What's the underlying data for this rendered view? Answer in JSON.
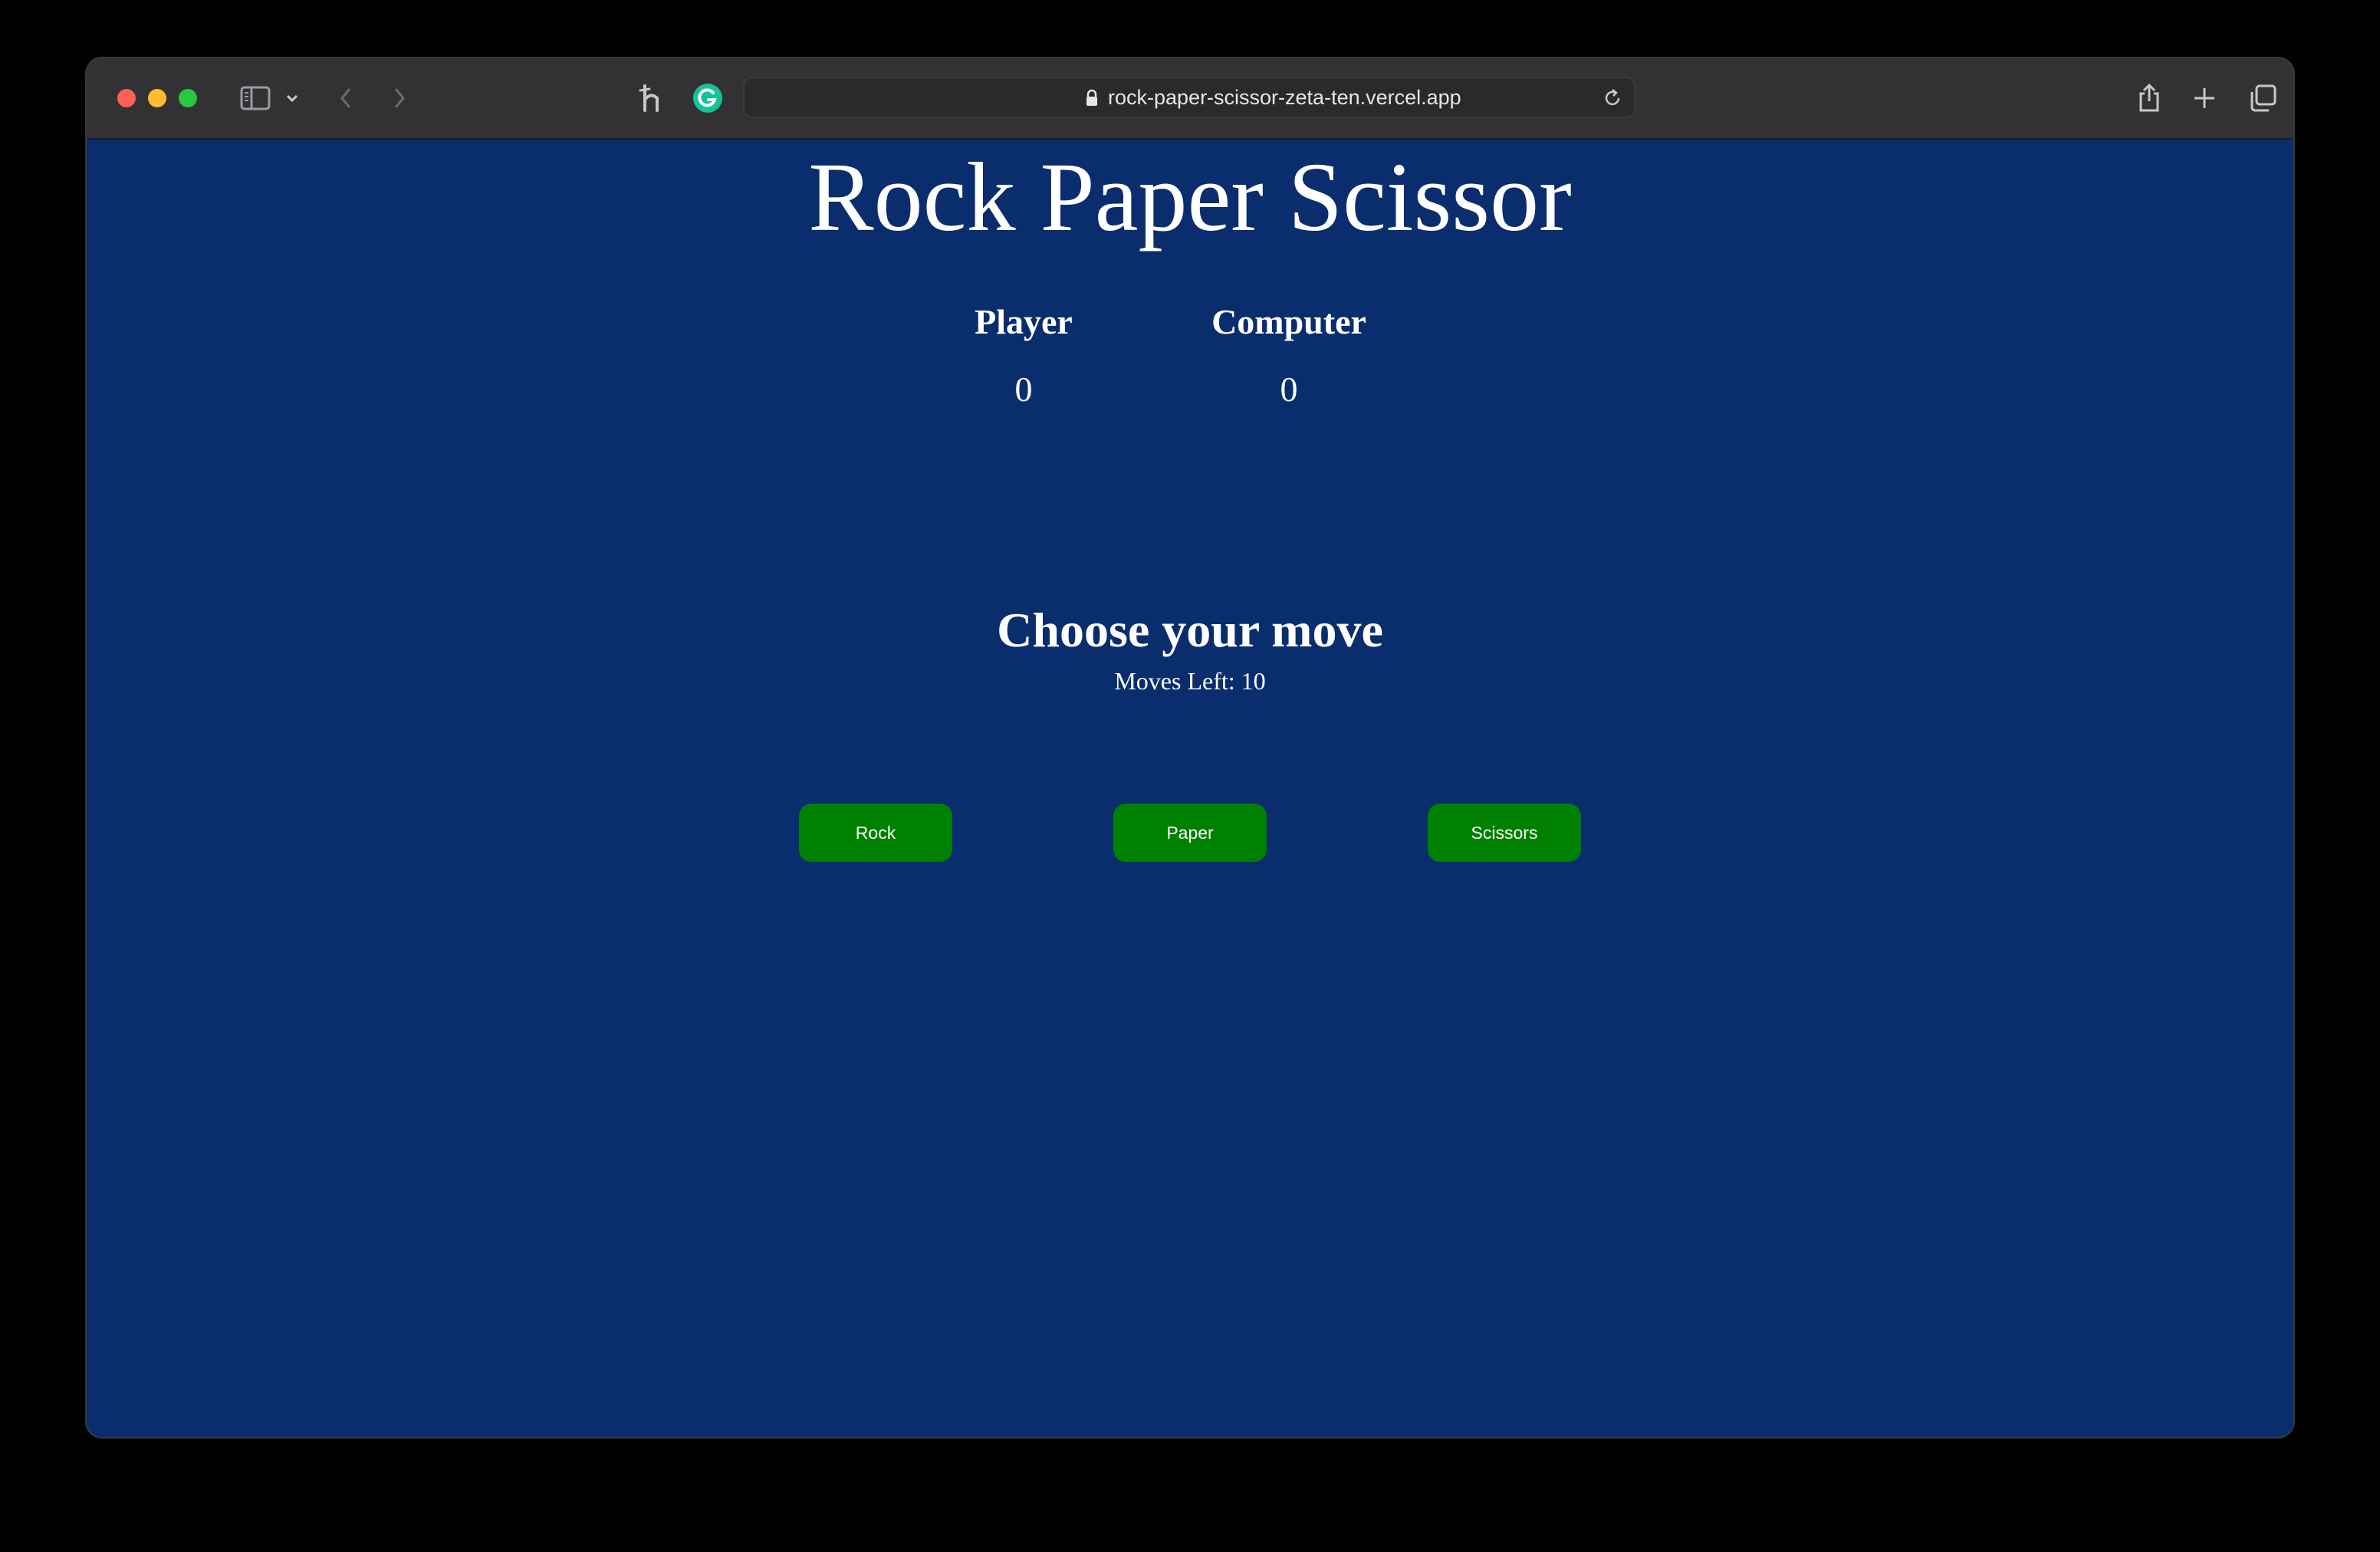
{
  "browser": {
    "url": "rock-paper-scissor-zeta-ten.vercel.app",
    "icons": [
      "sidebar-icon",
      "chevron-down-icon",
      "back-icon",
      "forward-icon",
      "honey-extension-icon",
      "grammarly-extension-icon",
      "lock-icon",
      "reload-icon",
      "share-icon",
      "new-tab-icon",
      "tab-overview-icon"
    ]
  },
  "game": {
    "title": "Rock Paper Scissor",
    "player_label": "Player",
    "computer_label": "Computer",
    "player_score": "0",
    "computer_score": "0",
    "prompt": "Choose your move",
    "moves_left": "Moves Left: 10",
    "buttons": {
      "rock": "Rock",
      "paper": "Paper",
      "scissors": "Scissors"
    }
  },
  "colors": {
    "page_background": "#0a2d6e",
    "button_background": "#008000",
    "toolbar_background": "#323234"
  }
}
